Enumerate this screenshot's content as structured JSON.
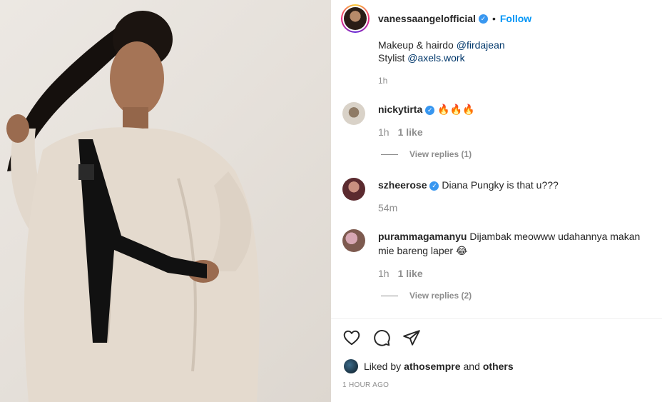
{
  "post": {
    "username": "vanessaangelofficial",
    "follow_label": "Follow",
    "dot": "•"
  },
  "caption": {
    "line1_prefix": "Makeup & hairdo ",
    "line1_mention": "@firdajean",
    "line2_prefix": "Stylist ",
    "line2_mention": "@axels.work",
    "time": "1h"
  },
  "comments": [
    {
      "username": "nickytirta",
      "text": "🔥🔥🔥",
      "time": "1h",
      "likes": "1 like",
      "replies": "View replies (1)"
    },
    {
      "username": "szheerose",
      "text": "Diana Pungky is that u???",
      "time": "54m"
    },
    {
      "username": "purammagamanyu",
      "text": "Dijambak meowww udahannya makan mie bareng laper 😂",
      "time": "1h",
      "likes": "1 like",
      "replies": "View replies (2)"
    }
  ],
  "likes": {
    "prefix": "Liked by ",
    "user": "athosempre",
    "middle": " and ",
    "others": "others"
  },
  "timestamp": "1 HOUR AGO",
  "icons": [
    "heart-icon",
    "comment-icon",
    "share-icon",
    "verified-icon"
  ],
  "colors": {
    "link_blue": "#0095f6",
    "mention": "#00376b",
    "verified": "#3897f0",
    "muted": "#8e8e8e"
  }
}
